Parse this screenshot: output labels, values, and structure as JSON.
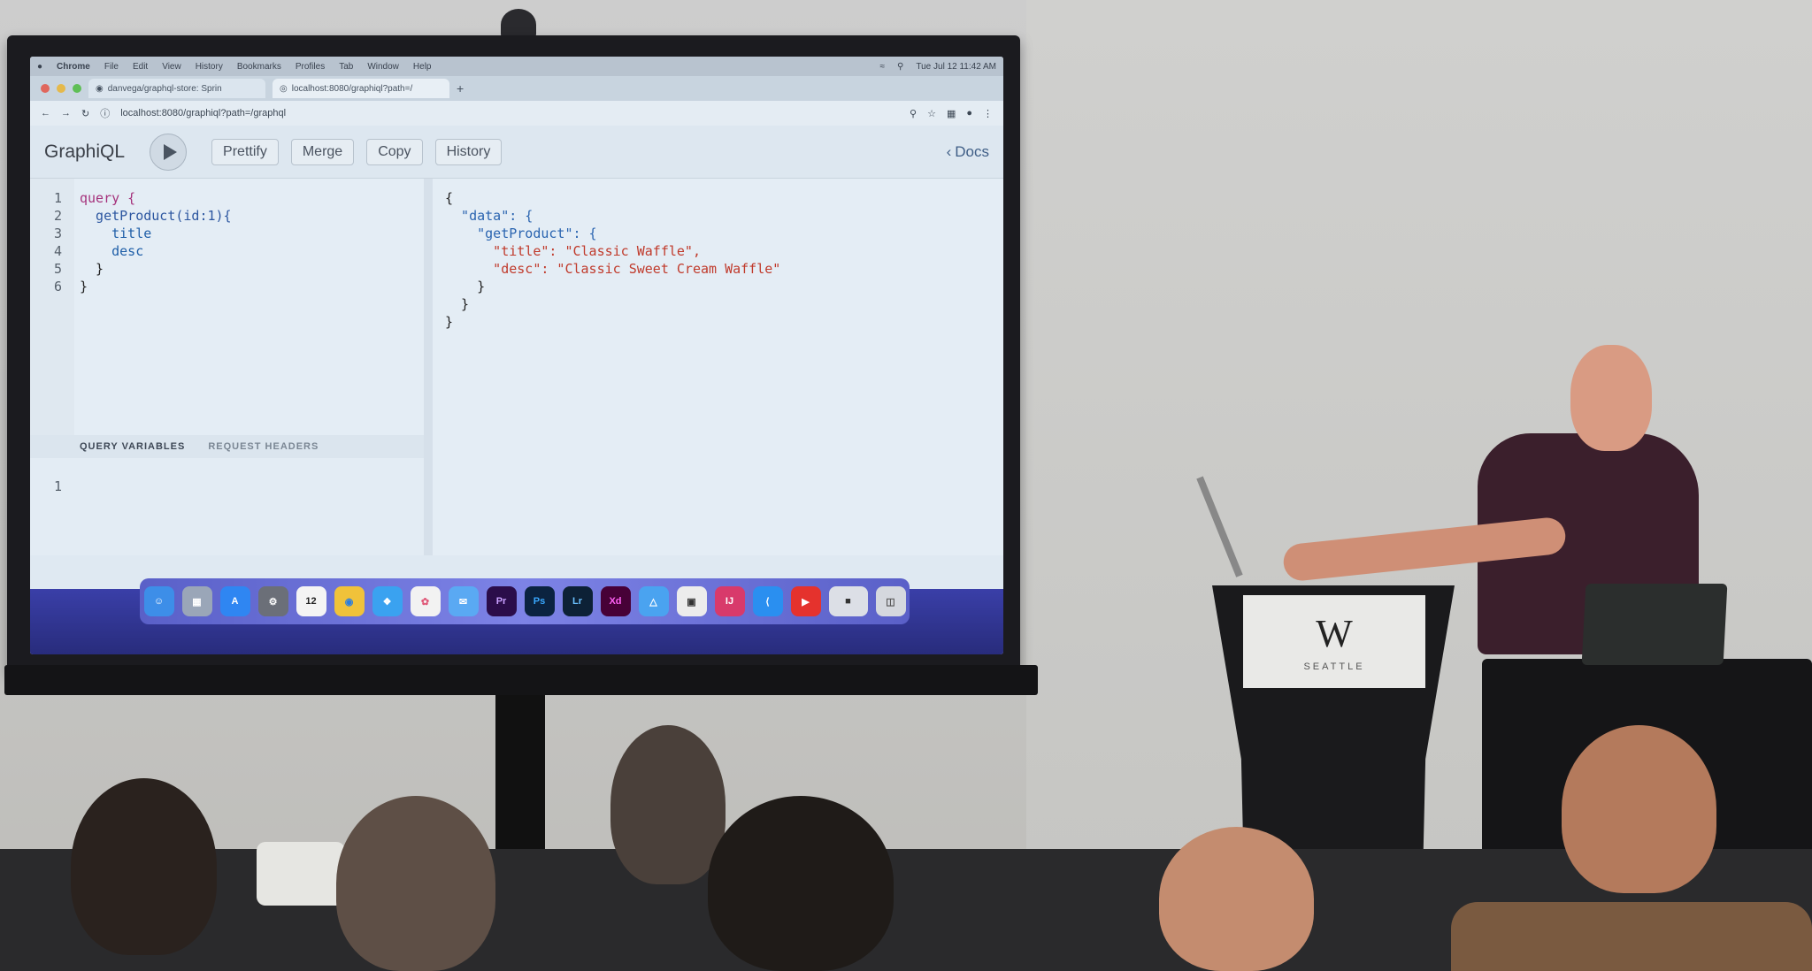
{
  "menubar": {
    "apple": "",
    "app": "Chrome",
    "items": [
      "File",
      "Edit",
      "View",
      "History",
      "Bookmarks",
      "Profiles",
      "Tab",
      "Window",
      "Help"
    ],
    "clock": "Tue Jul 12 11:42 AM"
  },
  "browser": {
    "tabs": [
      {
        "label": "danvega/graphql-store: Sprin"
      },
      {
        "label": "localhost:8080/graphiql?path=/"
      }
    ],
    "url": "localhost:8080/graphiql?path=/graphql"
  },
  "graphiql": {
    "logo": "GraphiQL",
    "buttons": {
      "prettify": "Prettify",
      "merge": "Merge",
      "copy": "Copy",
      "history": "History"
    },
    "docs": "Docs",
    "query_lines": [
      "query {",
      "  getProduct(id:1){",
      "    title",
      "    desc",
      "  }",
      "}"
    ],
    "line_numbers": [
      "1",
      "2",
      "3",
      "4",
      "5",
      "6"
    ],
    "result_lines": [
      "{",
      "  \"data\": {",
      "    \"getProduct\": {",
      "      \"title\": \"Classic Waffle\",",
      "      \"desc\": \"Classic Sweet Cream Waffle\"",
      "    }",
      "  }",
      "}"
    ],
    "tabs": {
      "variables": "QUERY VARIABLES",
      "headers": "REQUEST HEADERS"
    },
    "variables_line": "1"
  },
  "dock": {
    "apps": [
      "Finder",
      "Launchpad",
      "App Store",
      "System Preferences",
      "Calendar",
      "Chrome",
      "Safari",
      "Photos",
      "Mail",
      "Pr",
      "Ps",
      "Lr",
      "Xd",
      "Keynote",
      "Screenshot",
      "IntelliJ",
      "VS Code",
      "YouTube",
      "Preview",
      "Trash"
    ],
    "calendar_day": "12"
  },
  "podium": {
    "brand": "W",
    "city": "SEATTLE"
  }
}
